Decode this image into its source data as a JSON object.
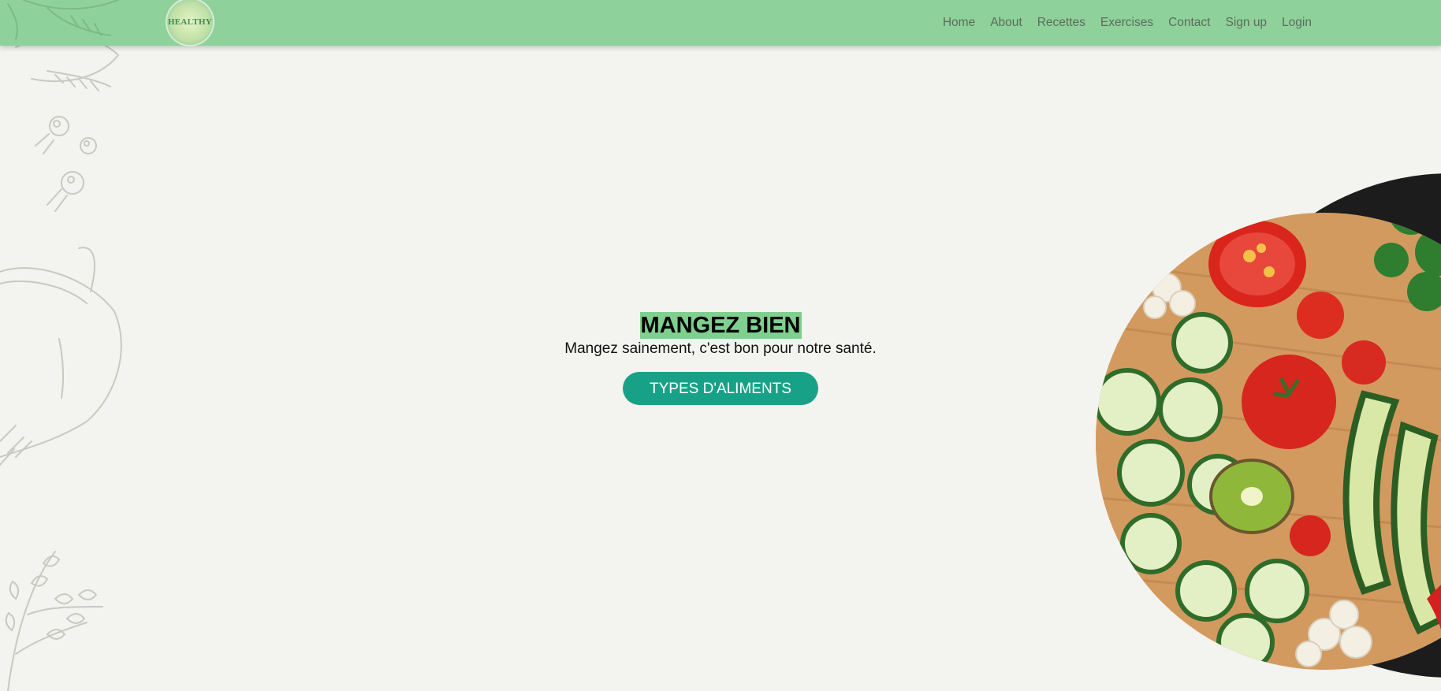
{
  "nav": {
    "logo_text": "HEALTHY",
    "links": [
      "Home",
      "About",
      "Recettes",
      "Exercises",
      "Contact",
      "Sign up",
      "Login"
    ]
  },
  "hero": {
    "title": "MANGEZ BIEN",
    "subtitle": "Mangez sainement, c'est bon pour notre santé.",
    "button_label": "TYPES D'ALIMENTS"
  },
  "colors": {
    "navbar": "#8fd19a",
    "background": "#f3f3ef",
    "title_highlight": "#7fcf8f",
    "button": "#17a287"
  },
  "icons": {
    "logo": "healthy-badge-logo",
    "decoration": "vegetable-sketch",
    "hero_image": "vegetable-platter-image"
  }
}
